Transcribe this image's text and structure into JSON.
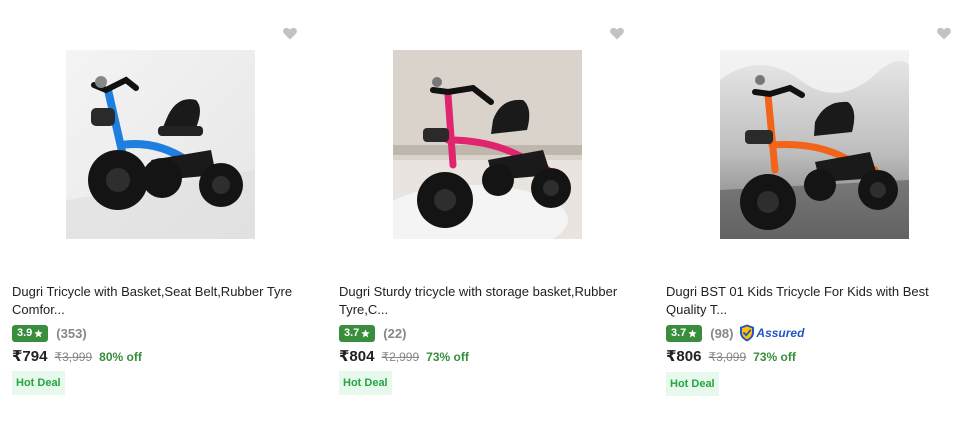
{
  "products": [
    {
      "title": "Dugri Tricycle with Basket,Seat Belt,Rubber Tyre Comfor...",
      "rating": "3.9",
      "reviews": "(353)",
      "price": "₹794",
      "mrp": "₹3,999",
      "discount": "80% off",
      "deal": "Hot Deal",
      "frame_color": "#1e7fe0",
      "assured": false
    },
    {
      "title": "Dugri Sturdy tricycle with storage basket,Rubber Tyre,C...",
      "rating": "3.7",
      "reviews": "(22)",
      "price": "₹804",
      "mrp": "₹2,999",
      "discount": "73% off",
      "deal": "Hot Deal",
      "frame_color": "#e0246e",
      "assured": false
    },
    {
      "title": "Dugri BST 01 Kids Tricycle For Kids with Best Quality T...",
      "rating": "3.7",
      "reviews": "(98)",
      "price": "₹806",
      "mrp": "₹3,099",
      "discount": "73% off",
      "deal": "Hot Deal",
      "frame_color": "#f26419",
      "assured": true,
      "assured_label": "Assured"
    }
  ],
  "colors": {
    "rating_badge": "#388e3c",
    "discount": "#388e3c",
    "deal_bg": "#e7f8ec",
    "assured": "#2455c3"
  },
  "icons": {
    "wishlist": "heart-icon",
    "rating": "star-icon",
    "assured": "flipkart-assured-icon"
  }
}
